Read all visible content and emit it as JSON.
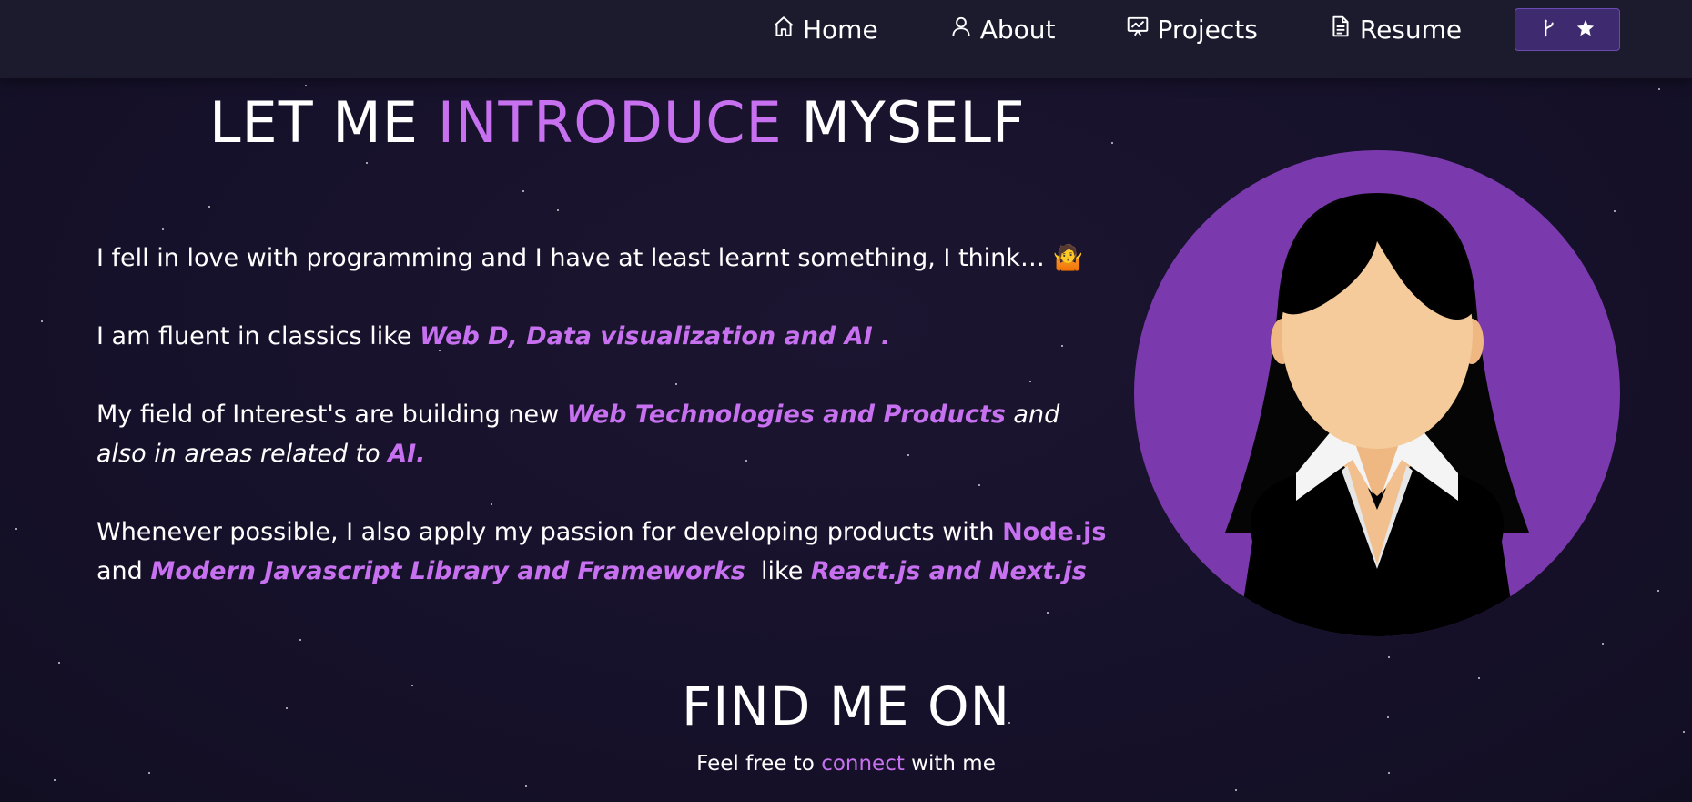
{
  "nav": {
    "items": [
      {
        "label": "Home",
        "icon": "home-icon"
      },
      {
        "label": "About",
        "icon": "user-icon"
      },
      {
        "label": "Projects",
        "icon": "presentation-icon"
      },
      {
        "label": "Resume",
        "icon": "document-icon"
      }
    ],
    "github_button": {
      "icons": [
        "git-fork-icon",
        "star-icon"
      ]
    }
  },
  "intro": {
    "heading_part1": "LET ME",
    "heading_highlight": "INTRODUCE",
    "heading_part2": "MYSELF",
    "para1": "I fell in love with programming and I have at least learnt something, I think… 🤷",
    "para2_text": "I am fluent in classics like ",
    "para2_highlight": "Web D, Data visualization and AI .",
    "para3_text": "My field of Interest's are building new  ",
    "para3_highlight": "Web Technologies and Products",
    "para3_italic": " and also in areas related to ",
    "para3_highlight2": "AI.",
    "para4_text": "Whenever possible, I also apply my passion for developing products with ",
    "para4_highlight": "Node.js",
    "para4_and": " and ",
    "para4_highlight2": "Modern Javascript Library and Frameworks",
    "para4_like": "  like ",
    "para4_highlight3": "React.js and Next.js"
  },
  "avatar": {
    "icon": "woman-avatar-icon"
  },
  "find_me": {
    "heading": "FIND ME ON",
    "sub_text": "Feel free to ",
    "sub_link": "connect",
    "sub_end": " with me"
  },
  "colors": {
    "accent": "#c770f0",
    "background": "#16112a",
    "navbar": "#1c1a2d",
    "avatar_circle": "#7a3aad"
  }
}
